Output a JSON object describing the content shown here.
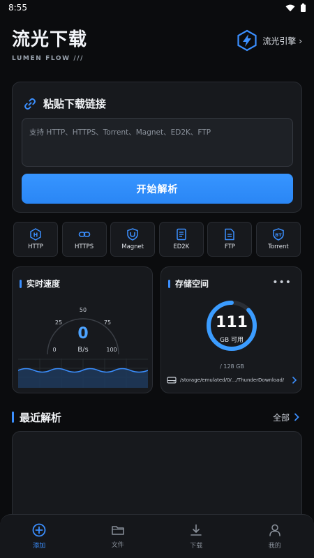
{
  "status_bar": {
    "time": "8:55"
  },
  "header": {
    "title": "流光下载",
    "subtitle": "LUMEN FLOW  ///",
    "engine_label": "流光引擎 ›"
  },
  "paste": {
    "title": "粘贴下载链接",
    "placeholder": "支持 HTTP、HTTPS、Torrent、Magnet、ED2K、FTP",
    "button_label": "开始解析"
  },
  "protocols": [
    {
      "label": "HTTP",
      "icon": "h-shield-icon",
      "glyph": "H"
    },
    {
      "label": "HTTPS",
      "icon": "link-icon",
      "glyph": ""
    },
    {
      "label": "Magnet",
      "icon": "magnet-shield-icon",
      "glyph": ""
    },
    {
      "label": "ED2K",
      "icon": "document-icon",
      "glyph": ""
    },
    {
      "label": "FTP",
      "icon": "file-icon",
      "glyph": ""
    },
    {
      "label": "Torrent",
      "icon": "bt-shield-icon",
      "glyph": "BT"
    }
  ],
  "speed": {
    "title": "实时速度",
    "value": "0",
    "unit": "B/s",
    "scale": [
      "0",
      "25",
      "50",
      "75",
      "100"
    ]
  },
  "storage": {
    "title": "存储空间",
    "free": "111",
    "free_unit": "GB 可用",
    "total": "/ 128 GB",
    "used_fraction": 0.13,
    "path": "/storage/emulated/0/.../ThunderDownload/"
  },
  "recent": {
    "title": "最近解析",
    "view_all": "全部"
  },
  "tabs": [
    {
      "label": "添加",
      "icon": "add-circle-icon",
      "active": true
    },
    {
      "label": "文件",
      "icon": "folder-icon",
      "active": false
    },
    {
      "label": "下载",
      "icon": "download-icon",
      "active": false
    },
    {
      "label": "我的",
      "icon": "user-icon",
      "active": false
    }
  ],
  "colors": {
    "accent": "#3b8fff",
    "background": "#0b0c0e",
    "card": "#17191d"
  }
}
